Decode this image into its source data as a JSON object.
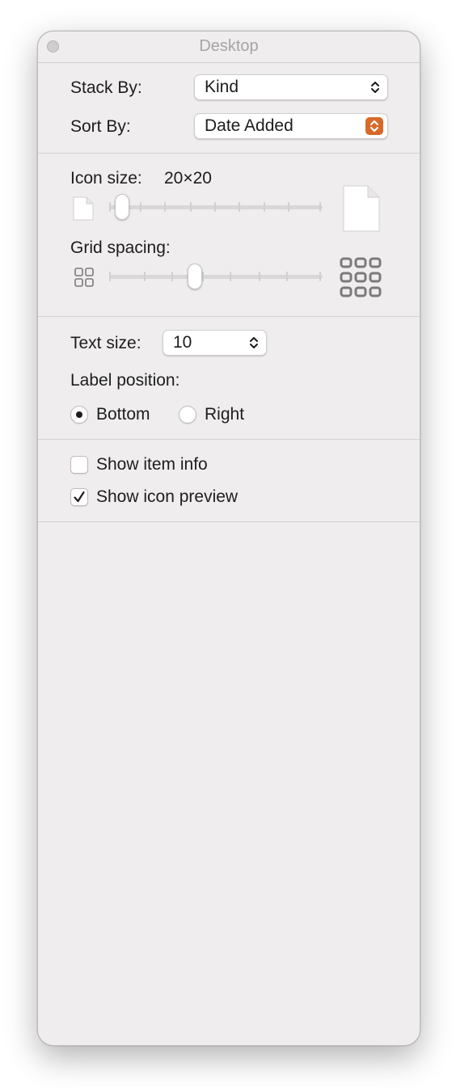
{
  "window": {
    "title": "Desktop"
  },
  "arrange": {
    "stack_by": {
      "label": "Stack By:",
      "value": "Kind"
    },
    "sort_by": {
      "label": "Sort By:",
      "value": "Date Added"
    }
  },
  "icon_size": {
    "label": "Icon size:",
    "value": "20×20",
    "slider_fraction": 0.06
  },
  "grid_spacing": {
    "label": "Grid spacing:",
    "slider_fraction": 0.4
  },
  "text": {
    "size_label": "Text size:",
    "size_value": "10",
    "label_position_label": "Label position:",
    "options": {
      "bottom": "Bottom",
      "right": "Right"
    },
    "selected": "Bottom"
  },
  "checkboxes": {
    "show_item_info": {
      "label": "Show item info",
      "checked": false
    },
    "show_icon_preview": {
      "label": "Show icon preview",
      "checked": true
    }
  },
  "colors": {
    "accent": "#d76a2a",
    "background": "#efedee"
  }
}
